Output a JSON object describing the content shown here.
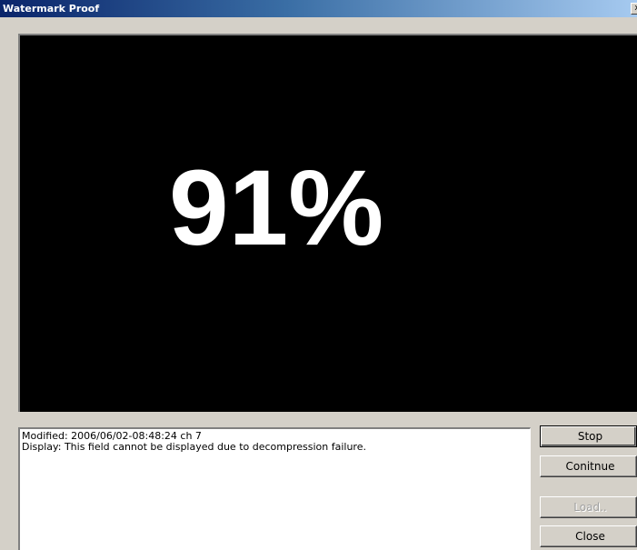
{
  "window": {
    "title": "Watermark Proof",
    "close_glyph": "x"
  },
  "display": {
    "percent_text": "91%",
    "progress_percent": 91
  },
  "log": {
    "lines": [
      "Modified: 2006/06/02-08:48:24 ch 7",
      "Display: This field cannot be displayed due to decompression failure."
    ]
  },
  "buttons": {
    "stop": "Stop",
    "continue": "Conitnue",
    "load": "Load..",
    "close": "Close"
  },
  "colors": {
    "titlebar_start": "#0a246a",
    "titlebar_end": "#a6caf0",
    "display_bg": "#000000",
    "display_text": "#ffffff",
    "window_bg": "#d4d0c8"
  }
}
